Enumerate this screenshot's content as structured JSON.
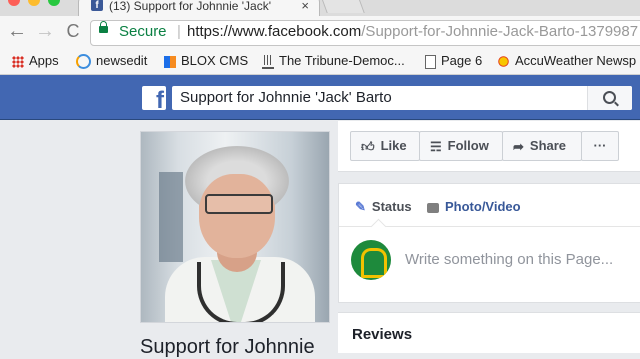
{
  "browser": {
    "tab": {
      "favicon": "f",
      "title": "(13) Support for Johnnie 'Jack'"
    },
    "nav": {
      "back_icon": "←",
      "forward_icon": "→",
      "reload_icon": "C"
    },
    "address": {
      "secure_label": "Secure",
      "separator": "|",
      "scheme": "https://",
      "host": "www.facebook.com",
      "path": "/Support-for-Johnnie-Jack-Barto-1379987"
    },
    "bookmarks": [
      {
        "label": "Apps",
        "icon": "apps-grid-icon"
      },
      {
        "label": "newsedit",
        "icon": "newsedit-icon"
      },
      {
        "label": "BLOX CMS",
        "icon": "blox-icon"
      },
      {
        "label": "The Tribune-Democ...",
        "icon": "tribune-icon"
      },
      {
        "label": "Page 6",
        "icon": "page-icon"
      },
      {
        "label": "AccuWeather Newsp",
        "icon": "accuweather-icon"
      }
    ]
  },
  "facebook": {
    "logo": "f",
    "search_value": "Support for Johnnie 'Jack' Barto",
    "search_icon": "search-icon",
    "brand_color": "#4267b2"
  },
  "page": {
    "name_partial": "Support for Johnnie",
    "actions": [
      {
        "label": "Like",
        "icon": "thumbs-up-icon"
      },
      {
        "label": "Follow",
        "icon": "rss-icon"
      },
      {
        "label": "Share",
        "icon": "share-arrow-icon"
      },
      {
        "label": "···",
        "icon": "more-icon"
      }
    ],
    "composer": {
      "tabs": [
        {
          "label": "Status",
          "icon": "pencil-icon"
        },
        {
          "label": "Photo/Video",
          "icon": "camera-icon"
        }
      ],
      "placeholder": "Write something on this Page..."
    },
    "reviews_title": "Reviews"
  }
}
